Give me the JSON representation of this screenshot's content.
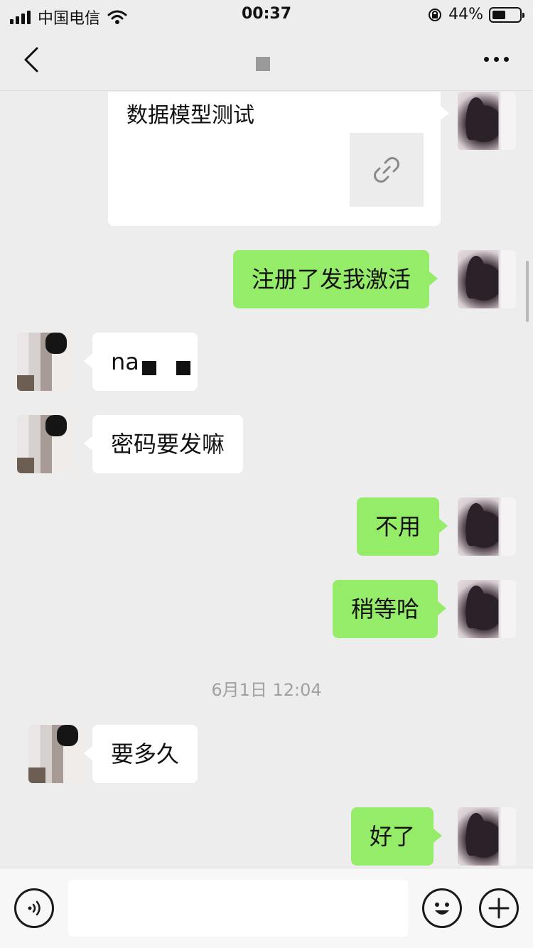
{
  "status_bar": {
    "carrier": "中国电信",
    "time": "00:37",
    "battery_percent": "44%",
    "battery_level": 0.44,
    "icons": [
      "signal-icon",
      "wifi-icon",
      "rotation-lock-icon",
      "battery-icon"
    ]
  },
  "nav_bar": {
    "back_icon": "chevron-left-icon",
    "more_icon": "more-dots-icon"
  },
  "messages": [
    {
      "side": "me",
      "type": "link",
      "title": "数据模型测试",
      "icon": "link-icon"
    },
    {
      "side": "me",
      "text": "注册了发我激活"
    },
    {
      "side": "other",
      "text": "na"
    },
    {
      "side": "other",
      "text": "密码要发嘛"
    },
    {
      "side": "me",
      "text": "不用"
    },
    {
      "side": "me",
      "text": "稍等哈"
    },
    {
      "side": "other",
      "text": "要多久"
    },
    {
      "side": "me",
      "text": "好了"
    }
  ],
  "timestamp": "6月1日 12:04",
  "input_bar": {
    "voice_icon": "voice-icon",
    "emoji_icon": "emoji-icon",
    "add_icon": "plus-icon",
    "message_value": ""
  },
  "colors": {
    "background": "#ededed",
    "my_bubble": "#95ec69",
    "their_bubble": "#ffffff",
    "timestamp_text": "#a0a0a0"
  }
}
